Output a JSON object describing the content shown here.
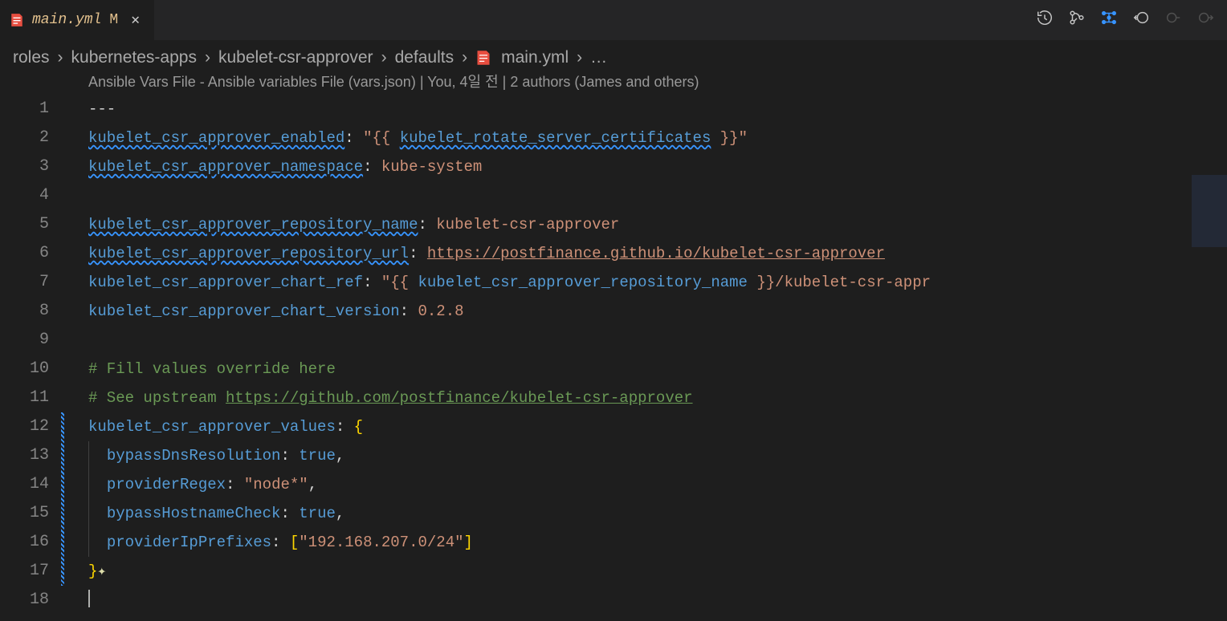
{
  "tab": {
    "filename": "main.yml",
    "modified_indicator": "M",
    "close_label": "✕"
  },
  "breadcrumb": {
    "items": [
      "roles",
      "kubernetes-apps",
      "kubelet-csr-approver",
      "defaults",
      "main.yml"
    ],
    "ellipsis": "…"
  },
  "codelens": "Ansible Vars File - Ansible variables File (vars.json) | You, 4일 전 | 2 authors (James and others)",
  "line_numbers": [
    "1",
    "2",
    "3",
    "4",
    "5",
    "6",
    "7",
    "8",
    "9",
    "10",
    "11",
    "12",
    "13",
    "14",
    "15",
    "16",
    "17",
    "18"
  ],
  "code": {
    "l1": "---",
    "l2_key": "kubelet_csr_approver_enabled",
    "l2_val": "\"{{ kubelet_rotate_server_certificates }}\"",
    "l2_jinja": "kubelet_rotate_server_certificates",
    "l3_key": "kubelet_csr_approver_namespace",
    "l3_val": "kube-system",
    "l5_key": "kubelet_csr_approver_repository_name",
    "l5_val": "kubelet-csr-approver",
    "l6_key": "kubelet_csr_approver_repository_url",
    "l6_val": "https://postfinance.github.io/kubelet-csr-approver",
    "l7_key": "kubelet_csr_approver_chart_ref",
    "l7_val_pre": "\"{{ kubelet_csr_approver_repository_name }}/kubelet-csr-appr",
    "l7_jinja": "kubelet_csr_approver_repository_name",
    "l7_suffix": "/kubelet-csr-appr",
    "l8_key": "kubelet_csr_approver_chart_version",
    "l8_val": "0.2.8",
    "l10_comment": "# Fill values override here",
    "l11_comment_pre": "# See upstream ",
    "l11_link": "https://github.com/postfinance/kubelet-csr-approver",
    "l12_key": "kubelet_csr_approver_values",
    "l13_key": "bypassDnsResolution",
    "l13_val": "true",
    "l14_key": "providerRegex",
    "l14_val": "\"node*\"",
    "l15_key": "bypassHostnameCheck",
    "l15_val": "true",
    "l16_key": "providerIpPrefixes",
    "l16_val": "\"192.168.207.0/24\""
  }
}
